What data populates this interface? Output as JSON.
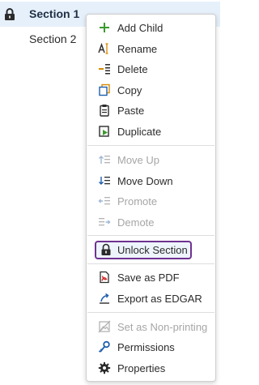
{
  "tree": {
    "items": [
      {
        "label": "Section 1",
        "selected": true,
        "icon": "lock-icon"
      },
      {
        "label": "Section 2",
        "selected": false
      }
    ]
  },
  "menu": {
    "items": [
      {
        "label": "Add Child",
        "icon": "plus-icon",
        "disabled": false
      },
      {
        "label": "Rename",
        "icon": "rename-icon",
        "disabled": false
      },
      {
        "label": "Delete",
        "icon": "delete-icon",
        "disabled": false
      },
      {
        "label": "Copy",
        "icon": "copy-icon",
        "disabled": false
      },
      {
        "label": "Paste",
        "icon": "paste-icon",
        "disabled": false
      },
      {
        "label": "Duplicate",
        "icon": "duplicate-icon",
        "disabled": false
      },
      {
        "label": "Move Up",
        "icon": "move-up-icon",
        "disabled": true
      },
      {
        "label": "Move Down",
        "icon": "move-down-icon",
        "disabled": false
      },
      {
        "label": "Promote",
        "icon": "promote-icon",
        "disabled": true
      },
      {
        "label": "Demote",
        "icon": "demote-icon",
        "disabled": true
      },
      {
        "label": "Unlock Section",
        "icon": "unlock-icon",
        "disabled": false,
        "highlighted": true
      },
      {
        "label": "Save as PDF",
        "icon": "pdf-icon",
        "disabled": false
      },
      {
        "label": "Export as EDGAR",
        "icon": "export-icon",
        "disabled": false
      },
      {
        "label": "Set as Non-printing",
        "icon": "non-printing-icon",
        "disabled": true
      },
      {
        "label": "Permissions",
        "icon": "key-icon",
        "disabled": false
      },
      {
        "label": "Properties",
        "icon": "gear-icon",
        "disabled": false
      }
    ]
  },
  "colors": {
    "accent_green": "#3a9a2e",
    "accent_blue": "#1f5fae",
    "highlight_border": "#6f3291",
    "disabled_text": "#a6a6a6"
  }
}
